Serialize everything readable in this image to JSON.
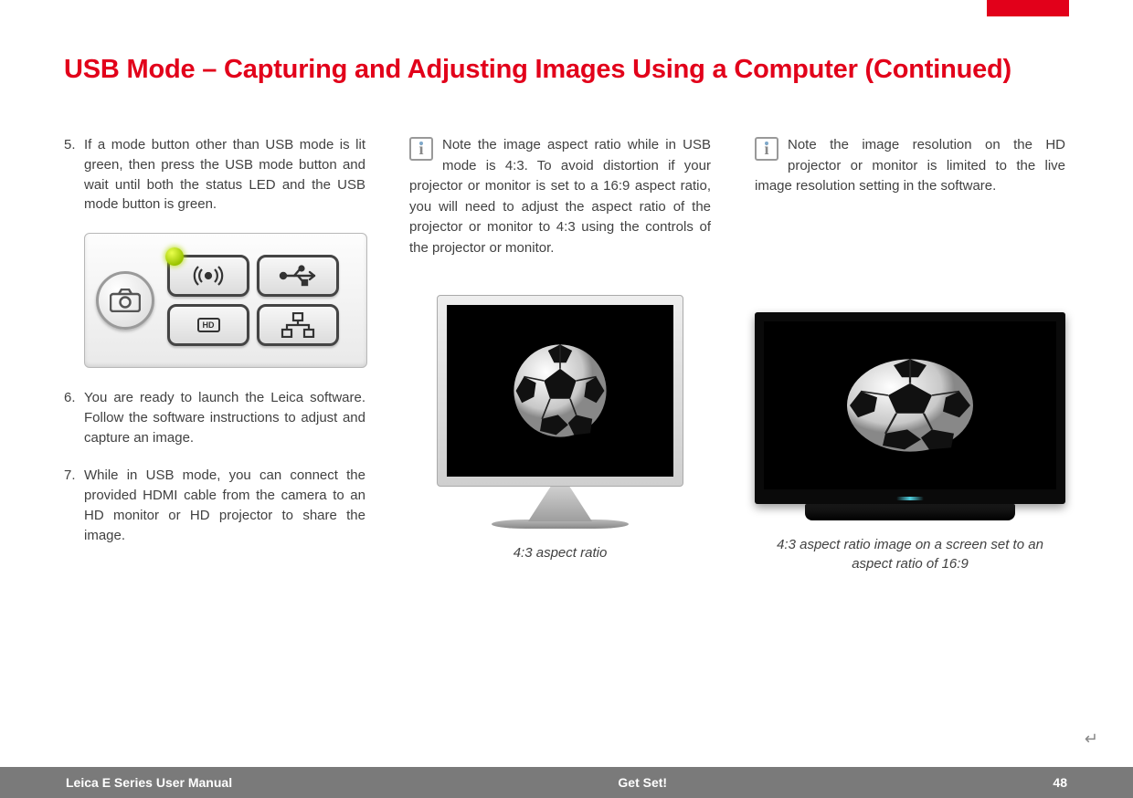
{
  "heading": "USB Mode – Capturing and Adjusting Images Using a Computer (Continued)",
  "steps": {
    "s5": {
      "num": "5.",
      "text": "If a mode button other than USB mode is lit green, then press the USB mode button and wait until both the status LED and the USB mode button is green."
    },
    "s6": {
      "num": "6.",
      "text": "You are ready to launch the Leica software. Follow the software instructions to adjust and capture an image."
    },
    "s7": {
      "num": "7.",
      "text": "While in USB mode, you can connect the provided HDMI cable from the camera to an HD monitor or HD projector to share the image."
    }
  },
  "notes": {
    "aspect": "Note the image aspect ratio while in USB mode is 4:3. To avoid distortion if your projector or monitor is set to a 16:9 aspect ratio, you will need to adjust the aspect ratio of the projector or monitor to 4:3 using the controls of the projector or monitor.",
    "resolution": "Note the image resolution on the HD projector or monitor is limited to the live image resolution setting in the software."
  },
  "captions": {
    "c43": "4:3 aspect ratio",
    "c169": "4:3 aspect ratio image on a screen set to an aspect ratio of 16:9"
  },
  "panel": {
    "hd_label": "HD"
  },
  "footer": {
    "title": "Leica E Series User Manual",
    "section": "Get Set!",
    "page": "48"
  },
  "glyphs": {
    "info": "i",
    "enter": "↵"
  }
}
